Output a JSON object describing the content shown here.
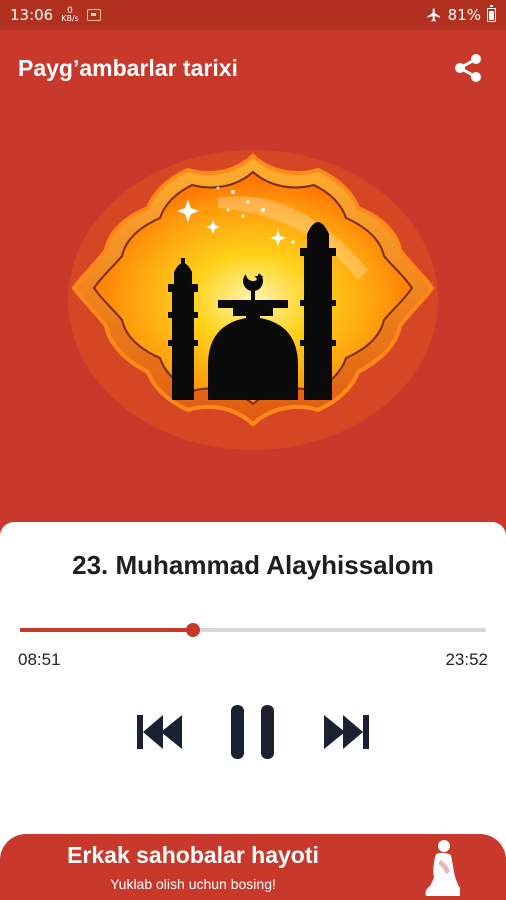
{
  "status_bar": {
    "time": "13:06",
    "data_speed_value": "0",
    "data_speed_unit": "KB/s",
    "battery": "81%",
    "icons": [
      "notification-icon",
      "airplane-icon",
      "battery-icon"
    ]
  },
  "app_bar": {
    "title": "Payg’ambarlar tarixi",
    "share_icon": "share-icon"
  },
  "player": {
    "track_title": "23. Muhammad Alayhissalom",
    "current_time": "08:51",
    "total_time": "23:52",
    "progress_fraction": 0.371,
    "controls": [
      "previous-icon",
      "pause-icon",
      "next-icon"
    ]
  },
  "banner": {
    "title": "Erkak sahobalar hayoti",
    "subtitle": "Yuklab olish uchun bosing!",
    "icon": "praying-man-icon"
  },
  "colors": {
    "primary": "#c8392b",
    "status_bar": "#b2301f",
    "frame_orange": "#f07a1a",
    "card": "#ffffff",
    "controls": "#1c2033"
  }
}
